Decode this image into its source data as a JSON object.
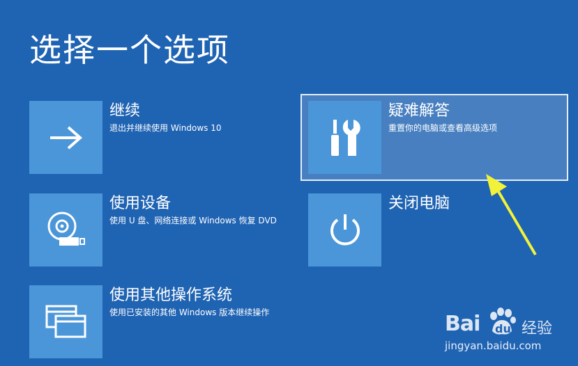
{
  "page": {
    "title": "选择一个选项"
  },
  "options": {
    "continue": {
      "label": "继续",
      "description": "退出并继续使用 Windows 10",
      "icon": "arrow-right-icon"
    },
    "use_device": {
      "label": "使用设备",
      "description": "使用 U 盘、网络连接或 Windows 恢复 DVD",
      "icon": "disc-drive-icon"
    },
    "other_os": {
      "label": "使用其他操作系统",
      "description": "使用已安装的其他 Windows 版本继续操作",
      "icon": "windows-stack-icon"
    },
    "troubleshoot": {
      "label": "疑难解答",
      "description": "重置你的电脑或查看高级选项",
      "icon": "tools-icon",
      "selected": true
    },
    "shutdown": {
      "label": "关闭电脑",
      "icon": "power-icon"
    }
  },
  "watermark": {
    "brand": "Bai",
    "paw_text": "du",
    "product": "经验",
    "url": "jingyan.baidu.com"
  },
  "colors": {
    "background": "#1f63b3",
    "tile": "#4b96d9",
    "annotation_arrow": "#f2f23a"
  }
}
